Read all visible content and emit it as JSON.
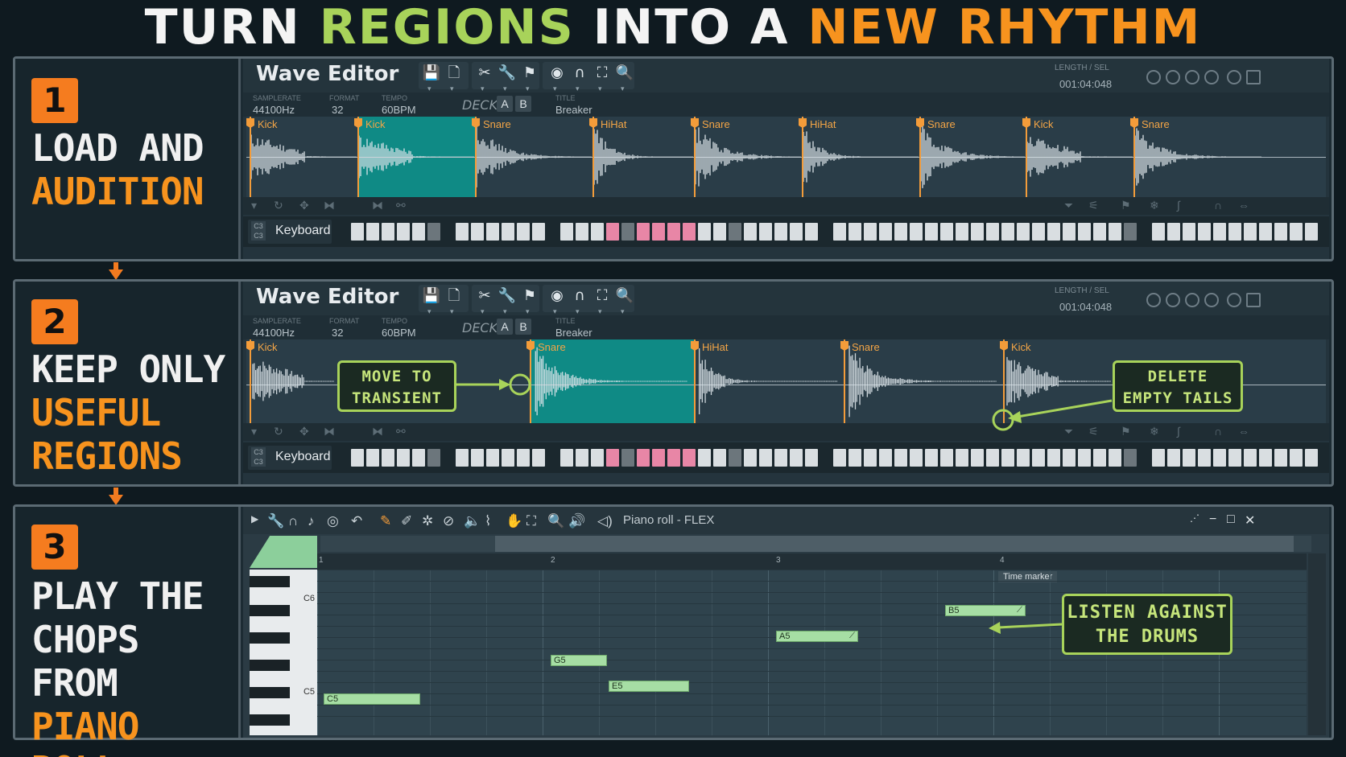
{
  "title": {
    "part1": "TURN ",
    "part2": "REGIONS",
    "part3": " INTO A ",
    "part4": "NEW RHYTHM"
  },
  "colors": {
    "accent_orange": "#f7931e",
    "accent_green": "#a8d35a",
    "selection_teal": "#0f8a85",
    "note_green": "#a6dea4"
  },
  "steps": [
    {
      "num": "1",
      "line1": "LOAD AND",
      "line2": "AUDITION"
    },
    {
      "num": "2",
      "line1": "KEEP ONLY",
      "line2": "USEFUL",
      "line3": "REGIONS"
    },
    {
      "num": "3",
      "line1": "PLAY THE",
      "line2": "CHOPS FROM",
      "line3": "PIANO ROLL"
    }
  ],
  "wave_editor": {
    "title": "Wave Editor",
    "length_label": "LENGTH / SEL",
    "length_value": "001:04:048",
    "samplerate_label": "SAMPLERATE",
    "samplerate": "44100Hz",
    "format_label": "FORMAT",
    "format": "32",
    "tempo_label": "TEMPO",
    "tempo": "60BPM",
    "deck_label": "DECK",
    "deck_a": "A",
    "deck_b": "B",
    "title_label": "TITLE",
    "title_value": "Breaker",
    "keyboard_label": "Keyboard",
    "keyboard_note": "C3",
    "keyboard_note2": "C3"
  },
  "editor1_regions": [
    "Kick",
    "Kick",
    "Snare",
    "HiHat",
    "Snare",
    "HiHat",
    "Snare",
    "Kick",
    "Snare"
  ],
  "editor2_regions": [
    "Kick",
    "Snare",
    "HiHat",
    "Snare",
    "Kick"
  ],
  "callouts": {
    "move_line1": "MOVE TO",
    "move_line2": "TRANSIENT",
    "delete_line1": "DELETE",
    "delete_line2": "EMPTY TAILS",
    "listen_line1": "LISTEN AGAINST",
    "listen_line2": "THE DRUMS"
  },
  "piano_roll": {
    "title": "Piano roll - FLEX",
    "bars": [
      "1",
      "2",
      "3",
      "4"
    ],
    "time_marker": "Time marker",
    "key_labels": [
      "C6",
      "C5"
    ],
    "notes": [
      "C5",
      "G5",
      "E5",
      "A5",
      "B5"
    ]
  }
}
